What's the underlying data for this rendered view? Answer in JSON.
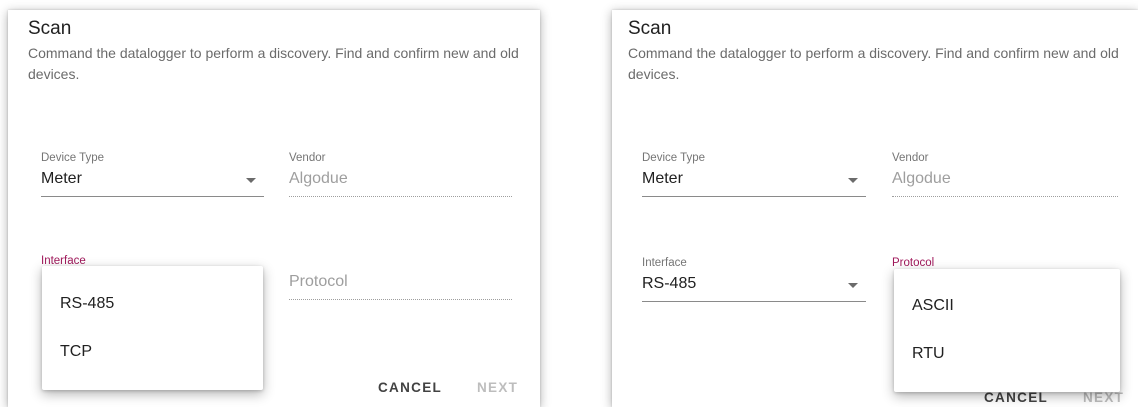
{
  "panels": [
    {
      "title": "Scan",
      "description": "Command the datalogger to perform a discovery. Find and confirm new and old devices.",
      "fields": {
        "device_type": {
          "label": "Device Type",
          "value": "Meter"
        },
        "vendor": {
          "label": "Vendor",
          "value": "Algodue"
        },
        "interface": {
          "label": "Interface",
          "value": ""
        },
        "protocol": {
          "label": "Protocol",
          "placeholder": "Protocol"
        }
      },
      "buttons": {
        "cancel": "CANCEL",
        "next": "NEXT"
      },
      "menu": {
        "items": [
          "RS-485",
          "TCP"
        ]
      }
    },
    {
      "title": "Scan",
      "description": "Command the datalogger to perform a discovery. Find and confirm new and old devices.",
      "fields": {
        "device_type": {
          "label": "Device Type",
          "value": "Meter"
        },
        "vendor": {
          "label": "Vendor",
          "value": "Algodue"
        },
        "interface": {
          "label": "Interface",
          "value": "RS-485"
        },
        "protocol": {
          "label": "Protocol"
        }
      },
      "buttons": {
        "cancel": "CANCEL",
        "next": "NEXT"
      },
      "menu": {
        "items": [
          "ASCII",
          "RTU"
        ]
      }
    }
  ],
  "colors": {
    "focus_label": "#a0195b",
    "primary_text": "#212121",
    "secondary_text": "#6b6b6b",
    "disabled_text": "#9e9e9e"
  },
  "icons": [
    "dropdown-arrow-icon"
  ]
}
